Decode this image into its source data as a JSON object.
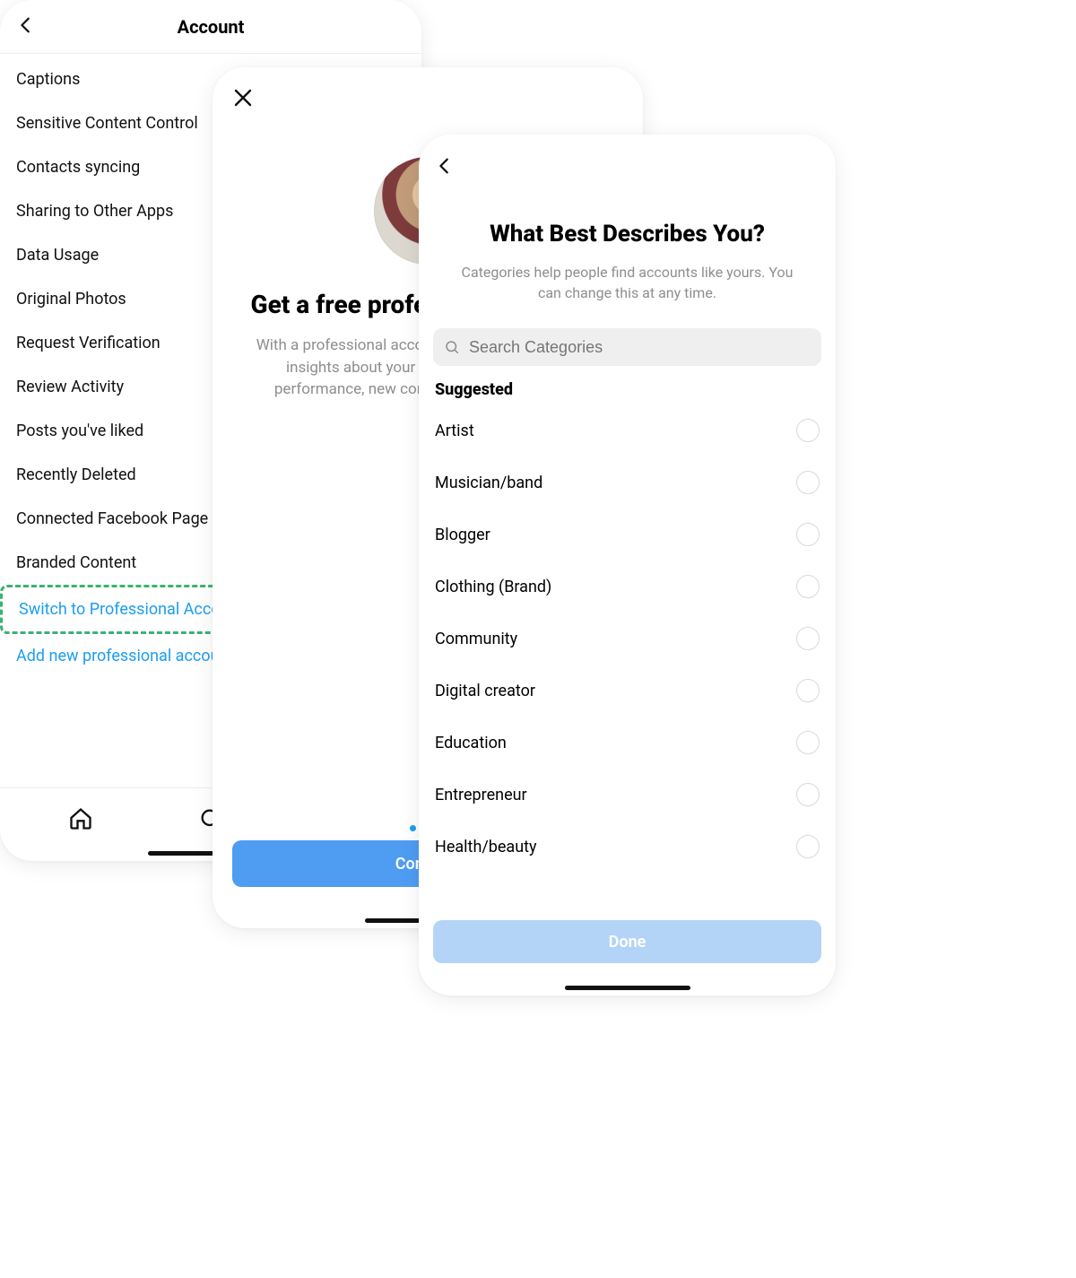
{
  "screen1": {
    "title": "Account",
    "items": [
      "Captions",
      "Sensitive Content Control",
      "Contacts syncing",
      "Sharing to Other Apps",
      "Data Usage",
      "Original Photos",
      "Request Verification",
      "Review Activity",
      "Posts you've liked",
      "Recently Deleted",
      "Connected Facebook Page",
      "Branded Content"
    ],
    "link_switch": "Switch to Professional Account",
    "link_add": "Add new professional account"
  },
  "screen2": {
    "heading": "Get a free professional account",
    "sub": "With a professional account, you can get access to insights about your followers and account performance, new contact options, and more.",
    "continue": "Continue"
  },
  "screen3": {
    "heading": "What Best Describes You?",
    "sub": "Categories help people find accounts like yours. You can change this at any time.",
    "search_placeholder": "Search Categories",
    "suggested_label": "Suggested",
    "categories": [
      "Artist",
      "Musician/band",
      "Blogger",
      "Clothing (Brand)",
      "Community",
      "Digital creator",
      "Education",
      "Entrepreneur",
      "Health/beauty"
    ],
    "done": "Done"
  }
}
